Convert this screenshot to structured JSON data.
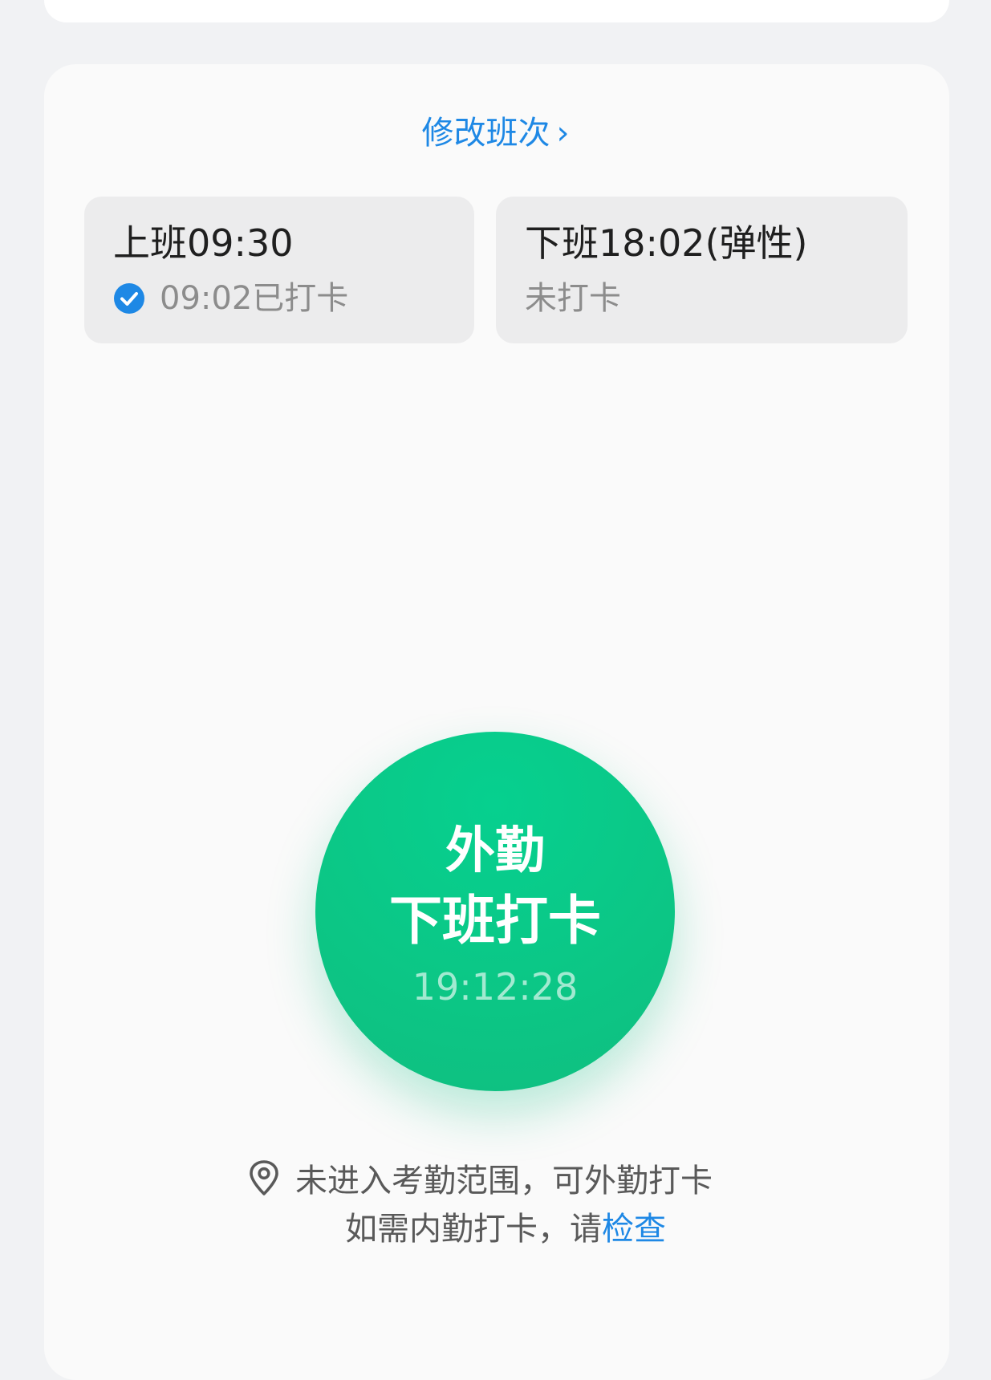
{
  "shift": {
    "modify_label": "修改班次",
    "chevron": "›"
  },
  "clock_in": {
    "title": "上班09:30",
    "status": "09:02已打卡",
    "status_icon": "check-circle-icon"
  },
  "clock_out": {
    "title": "下班18:02(弹性)",
    "status": "未打卡"
  },
  "punch": {
    "line1": "外勤",
    "line2": "下班打卡",
    "time": "19:12:28",
    "color": "#0cc685"
  },
  "notice": {
    "line1": "未进入考勤范围，可外勤打卡",
    "line2_prefix": "如需内勤打卡，请",
    "line2_link": "检查",
    "icon": "location-pin-icon"
  },
  "colors": {
    "accent": "#1e88e5",
    "background": "#f1f2f4",
    "card": "#fafafa"
  }
}
